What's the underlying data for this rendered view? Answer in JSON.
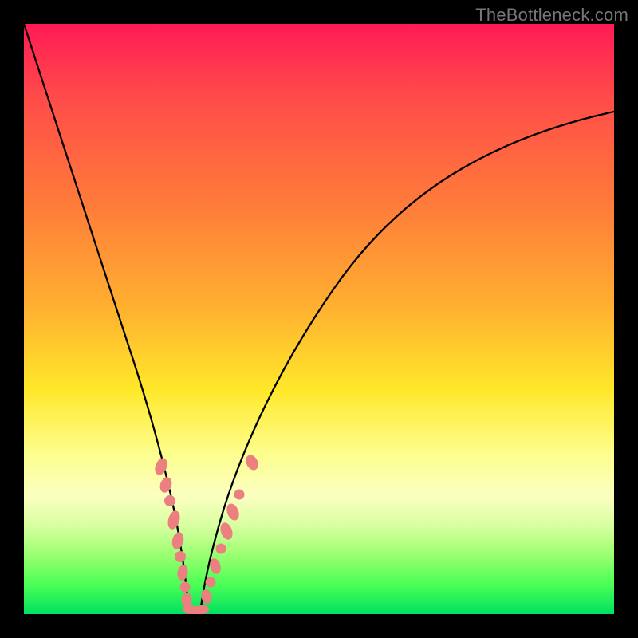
{
  "watermark": "TheBottleneck.com",
  "colors": {
    "background": "#000000",
    "gradient_top": "#ff1a55",
    "gradient_bottom": "#00e060",
    "curve": "#000000",
    "dots": "#ec7f7f"
  },
  "chart_data": {
    "type": "line",
    "title": "",
    "xlabel": "",
    "ylabel": "",
    "xlim": [
      0,
      100
    ],
    "ylim": [
      0,
      100
    ],
    "series": [
      {
        "name": "left-branch",
        "x": [
          0,
          4,
          8,
          12,
          15,
          18,
          20,
          22,
          23.5,
          24.5,
          25.5,
          26.5,
          27.3
        ],
        "y": [
          100,
          86,
          72,
          58,
          46,
          36,
          28,
          20,
          14,
          10,
          6,
          3,
          0
        ]
      },
      {
        "name": "right-branch",
        "x": [
          29.8,
          30.8,
          32,
          34,
          37,
          41,
          46,
          52,
          60,
          70,
          82,
          92,
          100
        ],
        "y": [
          0,
          3,
          7,
          13,
          22,
          34,
          46,
          56,
          66,
          74,
          80,
          83,
          85
        ]
      }
    ],
    "marker_clusters": [
      {
        "name": "left-cluster",
        "points": [
          {
            "x": 21.5,
            "y": 24
          },
          {
            "x": 22.3,
            "y": 21
          },
          {
            "x": 22.8,
            "y": 19
          },
          {
            "x": 23.6,
            "y": 15
          },
          {
            "x": 24.2,
            "y": 12.5
          },
          {
            "x": 24.7,
            "y": 10
          },
          {
            "x": 25.3,
            "y": 7.5
          },
          {
            "x": 25.8,
            "y": 5.5
          },
          {
            "x": 26.4,
            "y": 3
          },
          {
            "x": 27.0,
            "y": 1.2
          }
        ]
      },
      {
        "name": "valley-cluster",
        "points": [
          {
            "x": 27.6,
            "y": 0.4
          },
          {
            "x": 28.3,
            "y": 0.2
          },
          {
            "x": 29.0,
            "y": 0.2
          },
          {
            "x": 29.6,
            "y": 0.4
          }
        ]
      },
      {
        "name": "right-cluster",
        "points": [
          {
            "x": 30.5,
            "y": 2.5
          },
          {
            "x": 31.2,
            "y": 4.8
          },
          {
            "x": 31.9,
            "y": 7.2
          },
          {
            "x": 32.6,
            "y": 9.8
          },
          {
            "x": 33.4,
            "y": 12.8
          },
          {
            "x": 34.3,
            "y": 15.8
          },
          {
            "x": 35.3,
            "y": 19.0
          },
          {
            "x": 37.5,
            "y": 25.5
          }
        ]
      }
    ]
  }
}
